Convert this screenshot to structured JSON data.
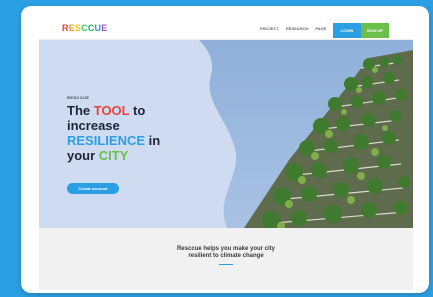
{
  "brand": {
    "letters": [
      {
        "char": "R",
        "color": "#e94235"
      },
      {
        "char": "E",
        "color": "#f39c12"
      },
      {
        "char": "S",
        "color": "#f1c40f"
      },
      {
        "char": "C",
        "color": "#2ecc71"
      },
      {
        "char": "C",
        "color": "#27ae60"
      },
      {
        "char": "U",
        "color": "#3498db"
      },
      {
        "char": "E",
        "color": "#9b59b6"
      }
    ]
  },
  "nav": {
    "items": [
      "PROJECT",
      "RESEARCH",
      "PAGE"
    ],
    "login_label": "LOGIN",
    "signup_label": "SIGN UP"
  },
  "hero": {
    "eyebrow": "RESCCUE",
    "headline": {
      "line1": {
        "a": "The ",
        "b": "TOOL",
        "c": " to"
      },
      "line2": "increase",
      "line3": {
        "a": "RESILIENCE",
        "b": " in"
      },
      "line4": {
        "a": "your ",
        "b": "CITY"
      }
    },
    "cta_label": "Create account"
  },
  "section": {
    "tagline_line1": "Resccue helps you make your city",
    "tagline_line2": "resilient to climate change"
  },
  "colors": {
    "background": "#2b9fe3",
    "login": "#2b9fe3",
    "signup": "#6cc04a",
    "accent_red": "#e8453c",
    "accent_blue": "#2b9fe3",
    "accent_green": "#6cc04a",
    "cta": "#2b9fe3"
  }
}
